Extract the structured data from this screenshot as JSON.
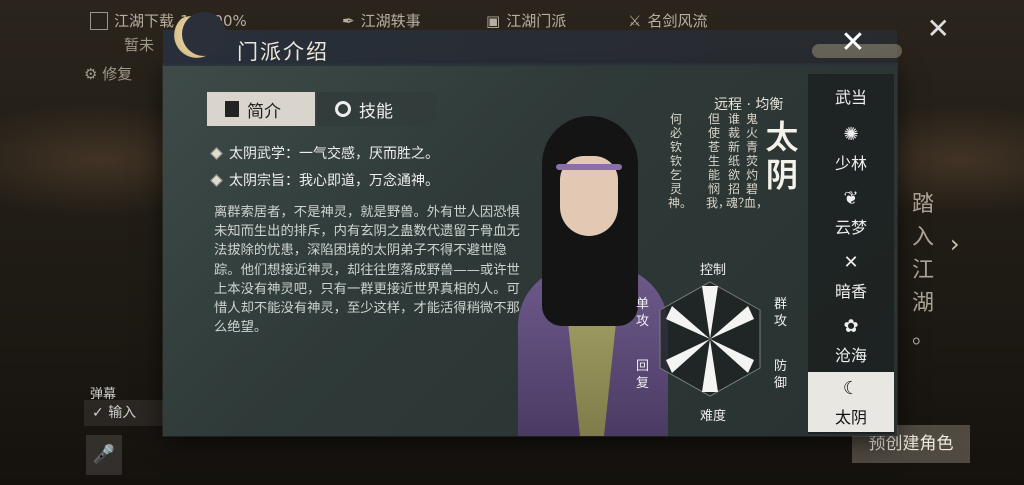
{
  "topbar": {
    "download": "江湖下载",
    "download_pct": "100.00%",
    "tab1": "江湖轶事",
    "tab2": "江湖门派",
    "tab3": "名剑风流",
    "left1": "暂未",
    "left2": "修复"
  },
  "panel": {
    "title": "门派介绍",
    "tabs": {
      "intro": "简介",
      "skill": "技能"
    }
  },
  "intro": {
    "line1": "太阴武学：一气交感，厌而胜之。",
    "line2": "太阴宗旨：我心即道，万念通神。",
    "description": "离群索居者，不是神灵，就是野兽。外有世人因恐惧未知而生出的排斥，内有玄阴之蛊数代遗留于骨血无法拔除的忧患，深陷困境的太阴弟子不得不避世隐踪。他们想接近神灵，却往往堕落成野兽——或许世上本没有神灵吧，只有一群更接近世界真相的人。可惜人却不能没有神灵，至少这样，才能活得稍微不那么绝望。"
  },
  "sect": {
    "type": "远程 · 均衡",
    "name": "太阴",
    "poem": [
      "鬼火青荧灼碧血，",
      "谁裁新纸欲招魂？",
      "但使苍生能悯我，",
      "何必钦钦乞灵神。"
    ]
  },
  "radar": {
    "top": "控制",
    "top_right": "群攻",
    "bottom_right": "防御",
    "bottom": "难度",
    "bottom_left": "回复",
    "top_left": "单攻"
  },
  "factions": [
    {
      "label": "武当",
      "icon": "wudang-icon",
      "glyph": "☯"
    },
    {
      "label": "少林",
      "icon": "shaolin-icon",
      "glyph": "✺"
    },
    {
      "label": "云梦",
      "icon": "yunmeng-icon",
      "glyph": "❦"
    },
    {
      "label": "暗香",
      "icon": "anxiang-icon",
      "glyph": "✕"
    },
    {
      "label": "沧海",
      "icon": "canghai-icon",
      "glyph": "✿"
    },
    {
      "label": "太阴",
      "icon": "taiyin-icon",
      "glyph": "☾"
    }
  ],
  "footer": {
    "danmu": "弹幕",
    "input": "输入",
    "create": "预创建角色",
    "enter": [
      "踏",
      "入",
      "江",
      "湖",
      "。"
    ]
  },
  "colors": {
    "panel": "#2f3a38",
    "active_tab": "#d9d5cc",
    "active_faction": "#e9e7e2"
  }
}
